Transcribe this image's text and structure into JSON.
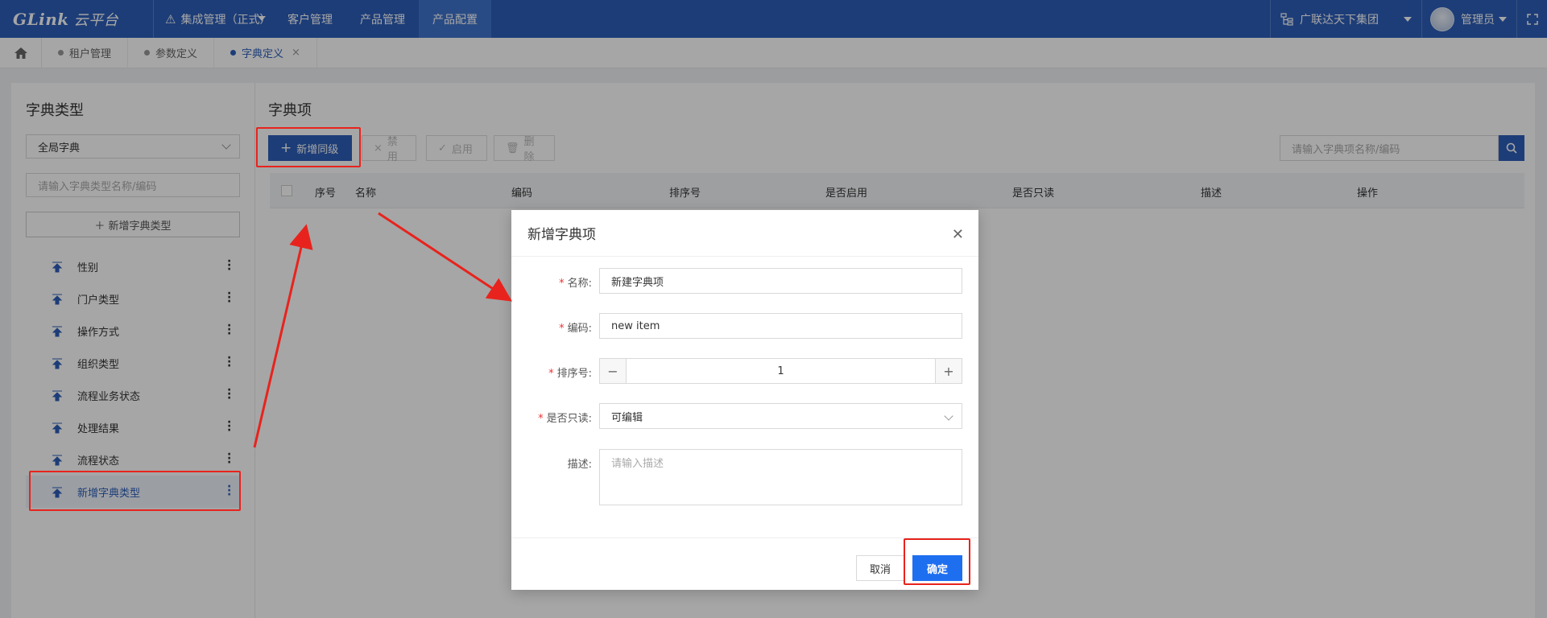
{
  "topnav": {
    "logo": "GLink",
    "logo_sub": "云平台",
    "env_select": "集成管理（正式）",
    "menu": [
      "客户管理",
      "产品管理",
      "产品配置"
    ],
    "org": "广联达天下集团",
    "user": "管理员"
  },
  "tabs": [
    {
      "label": "租户管理"
    },
    {
      "label": "参数定义"
    },
    {
      "label": "字典定义",
      "close": "×"
    }
  ],
  "left": {
    "title": "字典类型",
    "select_value": "全局字典",
    "search_placeholder": "请输入字典类型名称/编码",
    "add_button": "＋ 新增字典类型",
    "items": [
      "性别",
      "门户类型",
      "操作方式",
      "组织类型",
      "流程业务状态",
      "处理结果",
      "流程状态",
      "新增字典类型"
    ]
  },
  "right": {
    "title": "字典项",
    "toolbar": {
      "add_sibling": "新增同级",
      "disable": "禁用",
      "enable": "启用",
      "delete": "删除"
    },
    "search_placeholder": "请输入字典项名称/编码",
    "columns": [
      "序号",
      "名称",
      "编码",
      "排序号",
      "是否启用",
      "是否只读",
      "描述",
      "操作"
    ]
  },
  "modal": {
    "title": "新增字典项",
    "fields": {
      "name_label": "名称:",
      "name_value": "新建字典项",
      "code_label": "编码:",
      "code_value": "new item",
      "order_label": "排序号:",
      "order_value": "1",
      "readonly_label": "是否只读:",
      "readonly_value": "可编辑",
      "desc_label": "描述:",
      "desc_placeholder": "请输入描述"
    },
    "cancel": "取消",
    "confirm": "确定"
  },
  "colors": {
    "brand": "#2d5fb8",
    "confirm": "#1e6ff0",
    "annotation": "#e8231d"
  }
}
